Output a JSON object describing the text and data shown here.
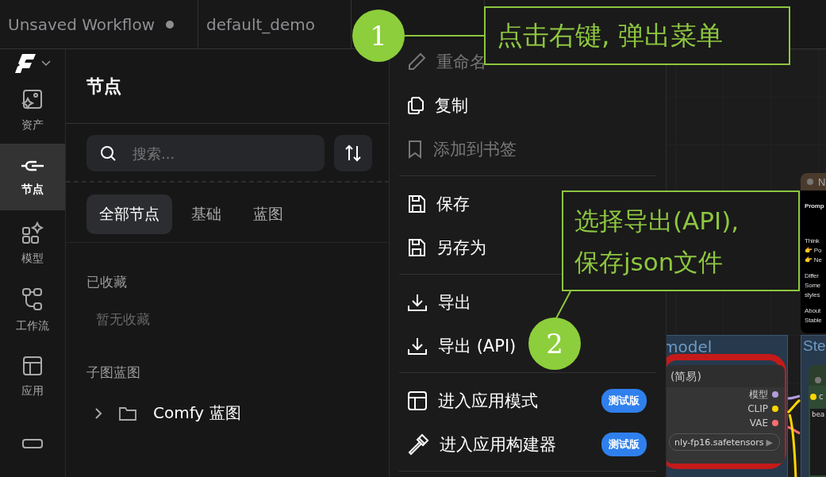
{
  "tabs": [
    {
      "label": "Unsaved Workflow",
      "modified": true
    },
    {
      "label": "default_demo",
      "modified": false
    }
  ],
  "sidebar": {
    "items": [
      {
        "label": "资产",
        "selected": false
      },
      {
        "label": "节点",
        "selected": true
      },
      {
        "label": "模型",
        "selected": false
      },
      {
        "label": "工作流",
        "selected": false
      },
      {
        "label": "应用",
        "selected": false
      },
      {
        "selected": false
      }
    ]
  },
  "panel": {
    "title": "节点",
    "search": {
      "placeholder": "搜索..."
    },
    "tabs": [
      {
        "label": "全部节点",
        "selected": true
      },
      {
        "label": "基础",
        "selected": false
      },
      {
        "label": "蓝图",
        "selected": false
      }
    ],
    "favorites": {
      "heading": "已收藏",
      "empty": "暂无收藏"
    },
    "blueprints": {
      "heading": "子图蓝图",
      "items": [
        {
          "label": "Comfy 蓝图",
          "expanded": false
        }
      ]
    }
  },
  "menu": {
    "items": [
      {
        "kind": "item",
        "label": "重命名",
        "disabled": true
      },
      {
        "kind": "item",
        "label": "复制",
        "disabled": false
      },
      {
        "kind": "item",
        "label": "添加到书签",
        "disabled": true
      },
      {
        "kind": "divider"
      },
      {
        "kind": "item",
        "label": "保存",
        "disabled": false
      },
      {
        "kind": "item",
        "label": "另存为",
        "disabled": false
      },
      {
        "kind": "divider"
      },
      {
        "kind": "item",
        "label": "导出",
        "disabled": false
      },
      {
        "kind": "item",
        "label": "导出 (API)",
        "disabled": false
      },
      {
        "kind": "divider"
      },
      {
        "kind": "item",
        "label": "进入应用模式",
        "disabled": false,
        "badge": "测试版"
      },
      {
        "kind": "item",
        "label": "进入应用构建器",
        "disabled": false,
        "badge": "测试版"
      },
      {
        "kind": "divider"
      }
    ]
  },
  "canvas": {
    "note": {
      "title": "N",
      "heading": "Promp",
      "paragraphs": [
        [
          "Think",
          "👉 Po",
          "👉 Ne"
        ],
        [
          "Differ",
          "Some",
          "styles"
        ],
        [
          "About",
          "Stable"
        ]
      ]
    },
    "groups": [
      {
        "title": "model"
      },
      {
        "title": "Ste"
      }
    ],
    "node": {
      "title": "(简易)",
      "outputs": [
        {
          "label": "模型",
          "color": "#b39ddb"
        },
        {
          "label": "CLIP",
          "color": "#ffd500"
        },
        {
          "label": "VAE",
          "color": "#ff6e6e"
        }
      ],
      "widget": "nly-fp16.safetensors",
      "widget_arrow": "▶"
    },
    "green_node": {
      "input": "c",
      "text": "bea"
    }
  },
  "annotations": [
    {
      "number": "1",
      "lines": [
        "点击右键, 弹出菜单"
      ]
    },
    {
      "number": "2",
      "lines": [
        "选择导出(API),",
        "保存json文件"
      ]
    }
  ]
}
